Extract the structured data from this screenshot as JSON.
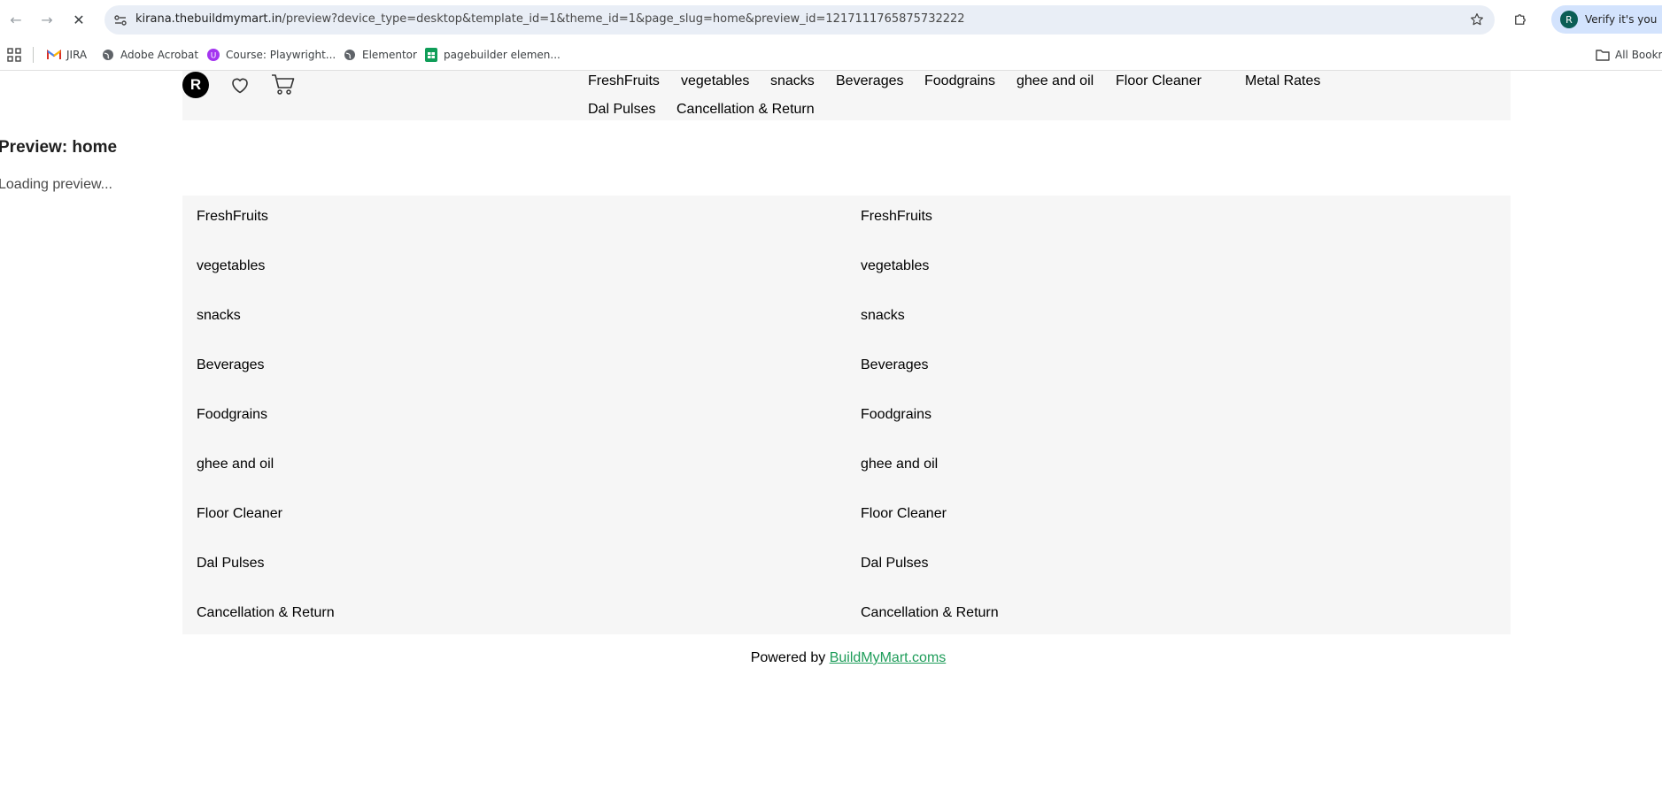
{
  "browser": {
    "url_host": "kirana.thebuildmymart.in",
    "url_path": "/preview?device_type=desktop&template_id=1&theme_id=1&page_slug=home&preview_id=1217111765875732222",
    "verify_label": "Verify it's you",
    "profile_initial": "R",
    "bookmarks": [
      "JIRA",
      "Adobe Acrobat",
      "Course: Playwright...",
      "Elementor",
      "pagebuilder elemen..."
    ],
    "all_bookmarks": "All Bookm"
  },
  "header": {
    "avatar_initial": "R",
    "nav": [
      "FreshFruits",
      "vegetables",
      "snacks",
      "Beverages",
      "Foodgrains",
      "ghee and oil",
      "Floor Cleaner",
      "Metal Rates",
      "Dal Pulses",
      "Cancellation & Return"
    ]
  },
  "preview": {
    "title": "Preview: home",
    "status": "Loading preview..."
  },
  "categories": {
    "left": [
      "FreshFruits",
      "vegetables",
      "snacks",
      "Beverages",
      "Foodgrains",
      "ghee and oil",
      "Floor Cleaner",
      "Dal Pulses",
      "Cancellation & Return"
    ],
    "right": [
      "FreshFruits",
      "vegetables",
      "snacks",
      "Beverages",
      "Foodgrains",
      "ghee and oil",
      "Floor Cleaner",
      "Dal Pulses",
      "Cancellation & Return"
    ]
  },
  "footer": {
    "powered_by": "Powered by",
    "link_text": "BuildMyMart.coms"
  },
  "colors": {
    "footer_link": "#1f9d5a",
    "panel_bg": "#f6f6f6",
    "omnibox_bg": "#e9eef6"
  }
}
